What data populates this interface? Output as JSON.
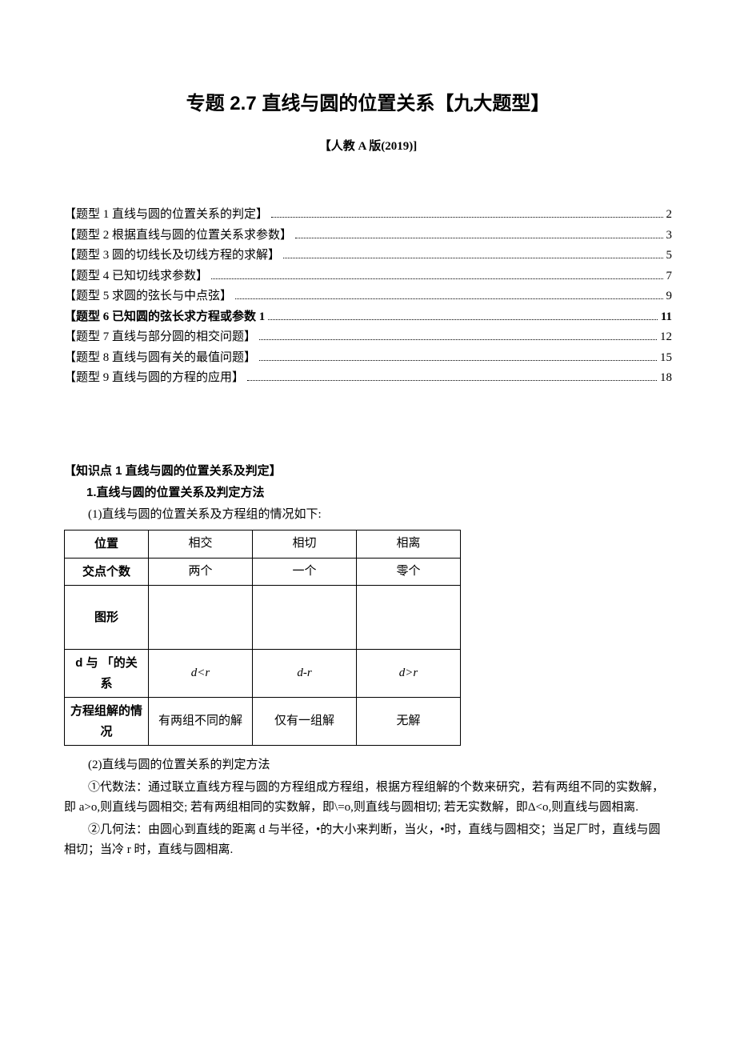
{
  "title": "专题 2.7 直线与圆的位置关系【九大题型】",
  "subtitle": "【人教 A 版(2019)]",
  "toc": [
    {
      "label": "【题型 1 直线与圆的位置关系的判定】",
      "page": "2",
      "bold": false
    },
    {
      "label": "【题型 2 根据直线与圆的位置关系求参数】",
      "page": "3",
      "bold": false
    },
    {
      "label": "【题型 3 圆的切线长及切线方程的求解】",
      "page": "5",
      "bold": false
    },
    {
      "label": "【题型 4 已知切线求参数】",
      "page": "7",
      "bold": false
    },
    {
      "label": "【题型 5 求圆的弦长与中点弦】",
      "page": "9",
      "bold": false
    },
    {
      "label": "【题型 6 已知圆的弦长求方程或参数 1",
      "page": "11",
      "bold": true
    },
    {
      "label": "【题型 7 直线与部分圆的相交问题】",
      "page": "12",
      "bold": false
    },
    {
      "label": "【题型 8 直线与圆有关的最值问题】",
      "page": "15",
      "bold": false
    },
    {
      "label": "【题型 9 直线与圆的方程的应用】",
      "page": "18",
      "bold": false
    }
  ],
  "section": {
    "kpoint": "【知识点 1 直线与圆的位置关系及判定】",
    "sub1": "1.直线与圆的位置关系及判定方法",
    "intro": "(1)直线与圆的位置关系及方程组的情况如下:"
  },
  "table": {
    "headers": {
      "c0": "位置",
      "c1": "相交",
      "c2": "相切",
      "c3": "相离"
    },
    "row1": {
      "c0": "交点个数",
      "c1": "两个",
      "c2": "一个",
      "c3": "零个"
    },
    "row2": {
      "c0": "图形",
      "c1": "",
      "c2": "",
      "c3": ""
    },
    "row3": {
      "c0": "d 与 「的关系",
      "c1": "d<r",
      "c2": "d-r",
      "c3": "d>r"
    },
    "row4": {
      "c0": "方程组解的情况",
      "c1": "有两组不同的解",
      "c2": "仅有一组解",
      "c3": "无解"
    }
  },
  "body": {
    "p2_lead": "(2)直线与圆的位置关系的判定方法",
    "p2_1": "①代数法：通过联立直线方程与圆的方程组成方程组，根据方程组解的个数来研究，若有两组不同的实数解，即 a>o,则直线与圆相交; 若有两组相同的实数解，即\\=o,则直线与圆相切; 若无实数解，即Δ<o,则直线与圆相离.",
    "p2_2": "②几何法：由圆心到直线的距离 d 与半径，•的大小来判断，当火，•时，直线与圆相交；当足厂时，直线与圆相切；当冷 r 时，直线与圆相离."
  }
}
